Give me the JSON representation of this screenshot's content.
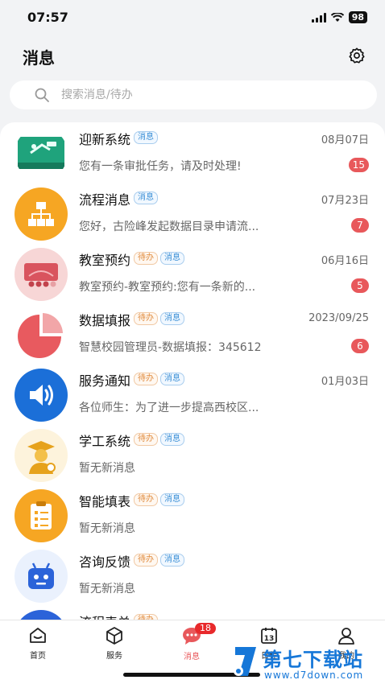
{
  "status_bar": {
    "time": "07:57",
    "battery": "98"
  },
  "header": {
    "title": "消息",
    "settings_icon": "gear-icon"
  },
  "search": {
    "placeholder": "搜索消息/待办"
  },
  "tag_labels": {
    "todo": "待办",
    "message": "消息"
  },
  "messages": [
    {
      "title": "迎新系统",
      "tags": [
        "消息"
      ],
      "date": "08月07日",
      "preview": "您有一条审批任务，请及时处理!",
      "badge": "15",
      "icon": "welcome-icon"
    },
    {
      "title": "流程消息",
      "tags": [
        "消息"
      ],
      "date": "07月23日",
      "preview": "您好，古险峰发起数据目录申请流...",
      "badge": "7",
      "icon": "flowchart-icon"
    },
    {
      "title": "教室预约",
      "tags": [
        "待办",
        "消息"
      ],
      "date": "06月16日",
      "preview": "教室预约-教室预约:您有一条新的...",
      "badge": "5",
      "icon": "classroom-icon"
    },
    {
      "title": "数据填报",
      "tags": [
        "待办",
        "消息"
      ],
      "date": "2023/09/25",
      "preview": "智慧校园管理员-数据填报：345612",
      "badge": "6",
      "icon": "pie-chart-icon"
    },
    {
      "title": "服务通知",
      "tags": [
        "待办",
        "消息"
      ],
      "date": "01月03日",
      "preview": "各位师生：为了进一步提高西校区...",
      "badge": "",
      "icon": "speaker-icon"
    },
    {
      "title": "学工系统",
      "tags": [
        "待办",
        "消息"
      ],
      "date": "",
      "preview": "暂无新消息",
      "badge": "",
      "icon": "graduate-icon"
    },
    {
      "title": "智能填表",
      "tags": [
        "待办",
        "消息"
      ],
      "date": "",
      "preview": "暂无新消息",
      "badge": "",
      "icon": "form-icon"
    },
    {
      "title": "咨询反馈",
      "tags": [
        "待办",
        "消息"
      ],
      "date": "",
      "preview": "暂无新消息",
      "badge": "",
      "icon": "robot-icon"
    },
    {
      "title": "流程表单",
      "tags": [
        "待办"
      ],
      "date": "",
      "preview": "",
      "badge": "",
      "icon": "flow-form-icon"
    }
  ],
  "tabbar": {
    "items": [
      {
        "label": "首页",
        "icon": "home-icon"
      },
      {
        "label": "服务",
        "icon": "cube-icon"
      },
      {
        "label": "消息",
        "icon": "message-icon",
        "badge": "18"
      },
      {
        "label": "日程",
        "icon": "calendar-icon",
        "day": "13"
      },
      {
        "label": "我的",
        "icon": "user-icon"
      }
    ]
  },
  "watermark": {
    "text": "第七下载站",
    "url": "www.d7down.com"
  },
  "colors": {
    "badge": "#e8585b",
    "todo_tag": "#e08a3c",
    "message_tag": "#3b8fd6",
    "watermark": "#1677d8"
  }
}
